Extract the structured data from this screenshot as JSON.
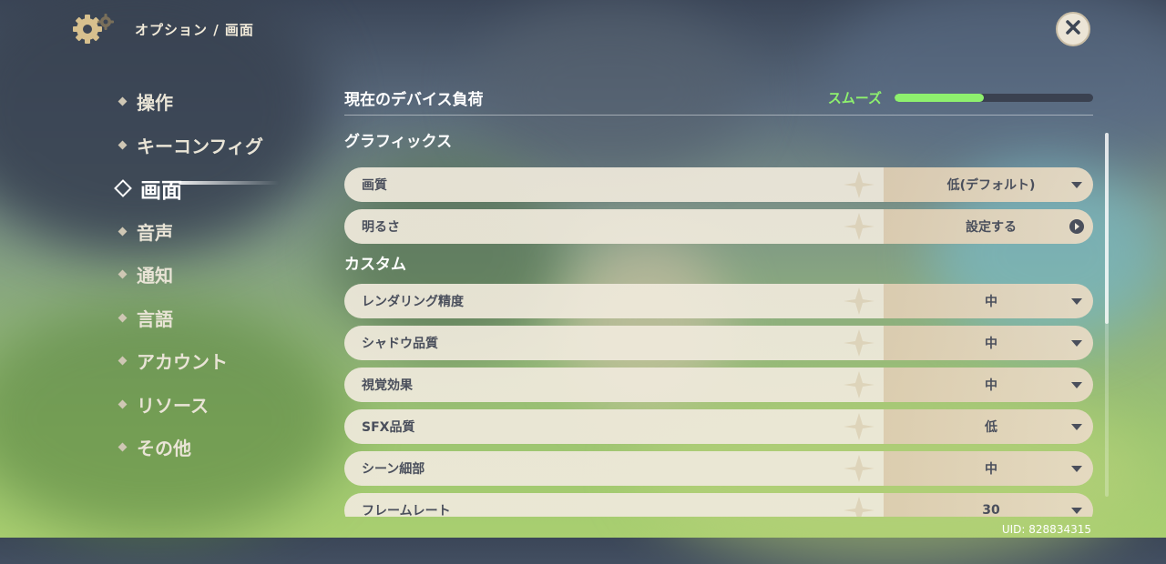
{
  "header": {
    "breadcrumb": "オプション / 画面"
  },
  "nav": {
    "items": [
      {
        "label": "操作"
      },
      {
        "label": "キーコンフィグ"
      },
      {
        "label": "画面"
      },
      {
        "label": "音声"
      },
      {
        "label": "通知"
      },
      {
        "label": "言語"
      },
      {
        "label": "アカウント"
      },
      {
        "label": "リソース"
      },
      {
        "label": "その他"
      }
    ],
    "active_index": 2
  },
  "device_load": {
    "title": "現在のデバイス負荷",
    "status": "スムーズ",
    "level": 0.45,
    "status_color": "#8ef06e"
  },
  "sections": {
    "graphics": {
      "title": "グラフィックス",
      "rows": [
        {
          "label": "画質",
          "value": "低(デフォルト)",
          "control": "dropdown"
        },
        {
          "label": "明るさ",
          "value": "設定する",
          "control": "link"
        }
      ]
    },
    "custom": {
      "title": "カスタム",
      "rows": [
        {
          "label": "レンダリング精度",
          "value": "中",
          "control": "dropdown"
        },
        {
          "label": "シャドウ品質",
          "value": "中",
          "control": "dropdown"
        },
        {
          "label": "視覚効果",
          "value": "中",
          "control": "dropdown"
        },
        {
          "label": "SFX品質",
          "value": "低",
          "control": "dropdown"
        },
        {
          "label": "シーン細部",
          "value": "中",
          "control": "dropdown"
        },
        {
          "label": "フレームレート",
          "value": "30",
          "control": "dropdown"
        }
      ]
    }
  },
  "uid": "UID: 828834315",
  "icons": {
    "settings": "gear-icon",
    "close": "close-icon"
  }
}
